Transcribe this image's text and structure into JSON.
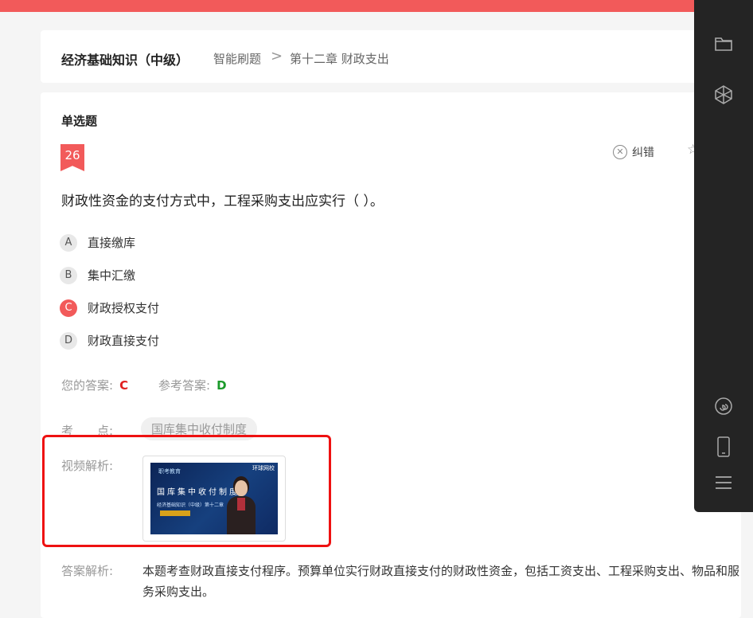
{
  "breadcrumb": {
    "course": "经济基础知识（中级）",
    "section": "智能刷题",
    "separator": ">",
    "chapter": "第十二章 财政支出"
  },
  "question": {
    "type": "单选题",
    "number": "26",
    "stem": "财政性资金的支付方式中，工程采购支出应实行（ ）。",
    "report_label": "纠错",
    "options": [
      {
        "letter": "A",
        "text": "直接缴库"
      },
      {
        "letter": "B",
        "text": "集中汇缴"
      },
      {
        "letter": "C",
        "text": "财政授权支付"
      },
      {
        "letter": "D",
        "text": "财政直接支付"
      }
    ]
  },
  "answer": {
    "your_label": "您的答案:",
    "your_value": "C",
    "ref_label": "参考答案:",
    "ref_value": "D"
  },
  "knowledge_point": {
    "label": "考　　点:",
    "tag": "国库集中收付制度"
  },
  "video": {
    "label": "视频解析:",
    "thumb_top_text": "职考教育",
    "thumb_brand": "环球网校",
    "thumb_title": "国库集中收付制度",
    "thumb_sub": "经济基础知识（中级）第十二章"
  },
  "explanation": {
    "label": "答案解析:",
    "text": "本题考查财政直接支付程序。预算单位实行财政直接支付的财政性资金，包括工资支出、工程采购支出、物品和服务采购支出。"
  },
  "colors": {
    "accent_red": "#f25a5a",
    "correct_green": "#1a9a2a",
    "wrong_red": "#e02020"
  }
}
